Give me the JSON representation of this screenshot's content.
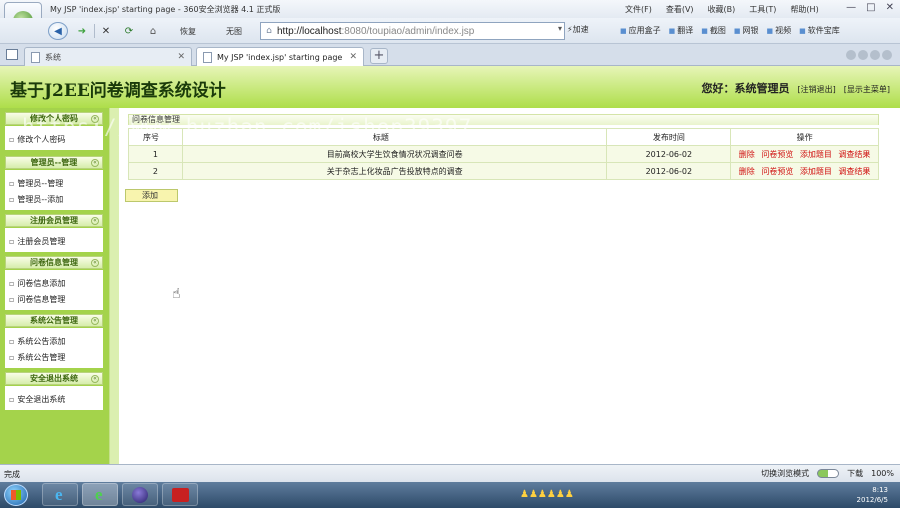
{
  "browser": {
    "window_title": "My JSP 'index.jsp' starting page - 360安全浏览器 4.1 正式版",
    "menu": [
      "文件(F)",
      "查看(V)",
      "收藏(B)",
      "工具(T)",
      "帮助(H)"
    ],
    "window_controls": [
      "—",
      "□",
      "✕"
    ],
    "nav": {
      "back": "◀",
      "forward": "➜",
      "stop": "✕",
      "refresh": "⟳",
      "home": "⌂",
      "restore": "恢复",
      "no_image": "无图",
      "address_icon": "⌂",
      "address_host": "http://localhost",
      "address_path": ":8080/toupiao/admin/index.jsp",
      "dropdown": "▾",
      "speedup": "⚡加速"
    },
    "toolbar_items": [
      "应用盒子",
      "翻译",
      "截图",
      "网银",
      "视频",
      "软件宝库"
    ],
    "tabs": [
      {
        "label": "系统",
        "close": "✕"
      },
      {
        "label": "My JSP 'index.jsp' starting page",
        "close": "✕"
      }
    ],
    "new_tab": "+",
    "status": {
      "text": "完成",
      "compat_mode": "切换浏览模式",
      "download": "下载",
      "zoom": "100%"
    }
  },
  "header": {
    "title": "基于J2EE问卷调查系统设计",
    "greeting": "您好：系统管理员",
    "logout_link": "[注销退出]",
    "home_link": "[显示主菜单]"
  },
  "sidebar": {
    "collapse_glyph": "«",
    "sections": [
      {
        "title": "修改个人密码",
        "items": [
          "修改个人密码"
        ]
      },
      {
        "title": "管理员--管理",
        "items": [
          "管理员--管理",
          "管理员--添加"
        ]
      },
      {
        "title": "注册会员管理",
        "items": [
          "注册会员管理"
        ]
      },
      {
        "title": "问卷信息管理",
        "items": [
          "问卷信息添加",
          "问卷信息管理"
        ]
      },
      {
        "title": "系统公告管理",
        "items": [
          "系统公告添加",
          "系统公告管理"
        ]
      },
      {
        "title": "安全退出系统",
        "items": [
          "安全退出系统"
        ]
      }
    ]
  },
  "main": {
    "panel_title": "问卷信息管理",
    "columns": [
      "序号",
      "标题",
      "发布时间",
      "操作"
    ],
    "rows": [
      {
        "num": "1",
        "title": "目前高校大学生饮食情况状况调查问卷",
        "date": "2012-06-02",
        "actions": [
          "删除",
          "问卷预览",
          "添加题目",
          "调查结果"
        ]
      },
      {
        "num": "2",
        "title": "关于杂志上化妆品广告投放特点的调查",
        "date": "2012-06-02",
        "actions": [
          "删除",
          "问卷预览",
          "添加题目",
          "调查结果"
        ]
      }
    ],
    "add_button": "添加"
  },
  "watermark": "https://www.huzhan.com/ishop39397",
  "taskbar": {
    "tray_icons": "♟♟♟♟♟♟",
    "time": "8:13",
    "date": "2012/6/5"
  },
  "colors": {
    "header_green": "#aede4a",
    "sidebar_green": "#a4d34b",
    "action_red": "#d01010",
    "add_button_yellow": "#f8f4ae"
  }
}
